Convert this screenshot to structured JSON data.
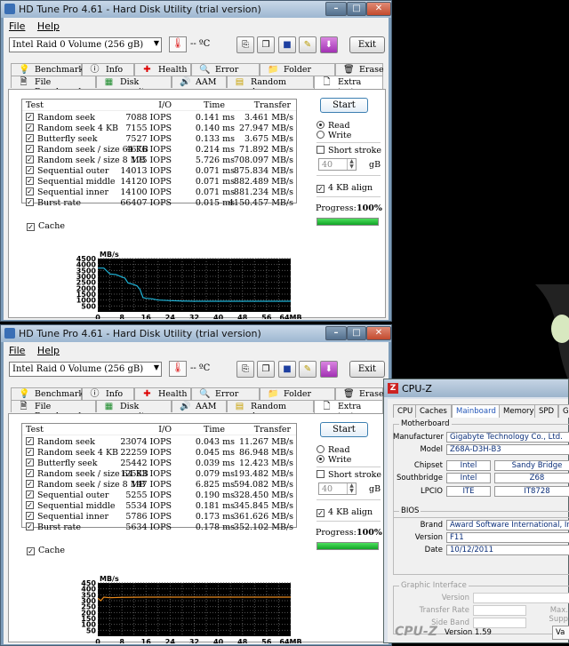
{
  "window": {
    "title": "HD Tune Pro 4.61 - Hard Disk Utility (trial version)",
    "menu": [
      "File",
      "Help"
    ],
    "drive": "Intel   Raid 0 Volume (256 gB)",
    "temp": "-- ºC",
    "exit": "Exit",
    "tabs_row1": [
      "Benchmark",
      "Info",
      "Health",
      "Error Scan",
      "Folder Usage",
      "Erase"
    ],
    "tabs_row2": [
      "File Benchmark",
      "Disk monitor",
      "AAM",
      "Random Access",
      "Extra tests"
    ],
    "columns": [
      "Test",
      "I/O",
      "Time",
      "Transfer"
    ],
    "start": "Start",
    "read": "Read",
    "write": "Write",
    "short_stroke": "Short stroke",
    "short_stroke_value": "40",
    "short_stroke_unit": "gB",
    "align": "4 KB align",
    "progress_label": "Progress:",
    "progress_value": "100%",
    "cache": "Cache"
  },
  "run1": {
    "mode": "read",
    "progress": 1.0,
    "rows": [
      {
        "test": "Random seek",
        "io": "7088 IOPS",
        "time": "0.141 ms",
        "transfer": "3.461 MB/s"
      },
      {
        "test": "Random seek 4 KB",
        "io": "7155 IOPS",
        "time": "0.140 ms",
        "transfer": "27.947 MB/s"
      },
      {
        "test": "Butterfly seek",
        "io": "7527 IOPS",
        "time": "0.133 ms",
        "transfer": "3.675 MB/s"
      },
      {
        "test": "Random seek / size 64 KB",
        "io": "4676 IOPS",
        "time": "0.214 ms",
        "transfer": "71.892 MB/s"
      },
      {
        "test": "Random seek / size 8 MB",
        "io": "175 IOPS",
        "time": "5.726 ms",
        "transfer": "708.097 MB/s"
      },
      {
        "test": "Sequential outer",
        "io": "14013 IOPS",
        "time": "0.071 ms",
        "transfer": "875.834 MB/s"
      },
      {
        "test": "Sequential middle",
        "io": "14120 IOPS",
        "time": "0.071 ms",
        "transfer": "882.489 MB/s"
      },
      {
        "test": "Sequential inner",
        "io": "14100 IOPS",
        "time": "0.071 ms",
        "transfer": "881.234 MB/s"
      },
      {
        "test": "Burst rate",
        "io": "66407 IOPS",
        "time": "0.015 ms",
        "transfer": "4150.457 MB/s"
      }
    ],
    "chart_data": {
      "type": "line",
      "ylabel": "MB/s",
      "xlabel": "",
      "x_unit": "MB",
      "ylim": [
        0,
        4500
      ],
      "xlim": [
        0,
        64
      ],
      "yticks": [
        4500,
        4000,
        3500,
        3000,
        2500,
        2000,
        1500,
        1000,
        500
      ],
      "xticks": [
        "0",
        "8",
        "16",
        "24",
        "32",
        "40",
        "48",
        "56",
        "64MB"
      ],
      "color": "#1fb3d6",
      "x": [
        0,
        2,
        4,
        6,
        7,
        8,
        9,
        10,
        12,
        13,
        14,
        15,
        16,
        18,
        20,
        24,
        28,
        32,
        40,
        48,
        56,
        64
      ],
      "y": [
        3700,
        3700,
        3200,
        3150,
        3050,
        2950,
        2850,
        2450,
        2300,
        2200,
        1900,
        1200,
        1150,
        1100,
        1000,
        950,
        920,
        900,
        900,
        900,
        900,
        900
      ]
    }
  },
  "run2": {
    "mode": "write",
    "progress": 1.0,
    "rows": [
      {
        "test": "Random seek",
        "io": "23074 IOPS",
        "time": "0.043 ms",
        "transfer": "11.267 MB/s"
      },
      {
        "test": "Random seek 4 KB",
        "io": "22259 IOPS",
        "time": "0.045 ms",
        "transfer": "86.948 MB/s"
      },
      {
        "test": "Butterfly seek",
        "io": "25442 IOPS",
        "time": "0.039 ms",
        "transfer": "12.423 MB/s"
      },
      {
        "test": "Random seek / size 64 KB",
        "io": "12583 IOPS",
        "time": "0.079 ms",
        "transfer": "193.482 MB/s"
      },
      {
        "test": "Random seek / size 8 MB",
        "io": "147 IOPS",
        "time": "6.825 ms",
        "transfer": "594.082 MB/s"
      },
      {
        "test": "Sequential outer",
        "io": "5255 IOPS",
        "time": "0.190 ms",
        "transfer": "328.450 MB/s"
      },
      {
        "test": "Sequential middle",
        "io": "5534 IOPS",
        "time": "0.181 ms",
        "transfer": "345.845 MB/s"
      },
      {
        "test": "Sequential inner",
        "io": "5786 IOPS",
        "time": "0.173 ms",
        "transfer": "361.626 MB/s"
      },
      {
        "test": "Burst rate",
        "io": "5634 IOPS",
        "time": "0.178 ms",
        "transfer": "352.102 MB/s"
      }
    ],
    "chart_data": {
      "type": "line",
      "ylabel": "MB/s",
      "xlabel": "",
      "x_unit": "MB",
      "ylim": [
        0,
        450
      ],
      "xlim": [
        0,
        64
      ],
      "yticks": [
        450,
        400,
        350,
        300,
        250,
        200,
        150,
        100,
        50
      ],
      "xticks": [
        "0",
        "8",
        "16",
        "24",
        "32",
        "40",
        "48",
        "56",
        "64MB"
      ],
      "color": "#e8891c",
      "x": [
        0,
        1,
        2,
        4,
        8,
        16,
        24,
        32,
        40,
        48,
        56,
        64
      ],
      "y": [
        320,
        300,
        330,
        325,
        328,
        330,
        330,
        330,
        330,
        330,
        330,
        330
      ]
    }
  },
  "cpuz": {
    "title": "CPU-Z",
    "tabs": [
      "CPU",
      "Caches",
      "Mainboard",
      "Memory",
      "SPD",
      "Gra"
    ],
    "motherboard": "Motherboard",
    "manufacturer_label": "Manufacturer",
    "manufacturer": "Gigabyte Technology Co., Ltd.",
    "model_label": "Model",
    "model": "Z68A-D3H-B3",
    "chipset_label": "Chipset",
    "chipset_vendor": "Intel",
    "chipset": "Sandy Bridge",
    "southbridge_label": "Southbridge",
    "southbridge_vendor": "Intel",
    "southbridge": "Z68",
    "lpcio_label": "LPCIO",
    "lpcio_vendor": "ITE",
    "lpcio": "IT8728",
    "bios": "BIOS",
    "brand_label": "Brand",
    "brand": "Award Software International, Inc.",
    "version_label": "Version",
    "version": "F11",
    "date_label": "Date",
    "date": "10/12/2011",
    "graphic": "Graphic Interface",
    "g_version": "Version",
    "g_transfer": "Transfer Rate",
    "g_max": "Max. Supp",
    "g_side": "Side Band",
    "footer": "CPU-Z",
    "footer_version": "Version 1.59",
    "footer_btn": "Va"
  }
}
